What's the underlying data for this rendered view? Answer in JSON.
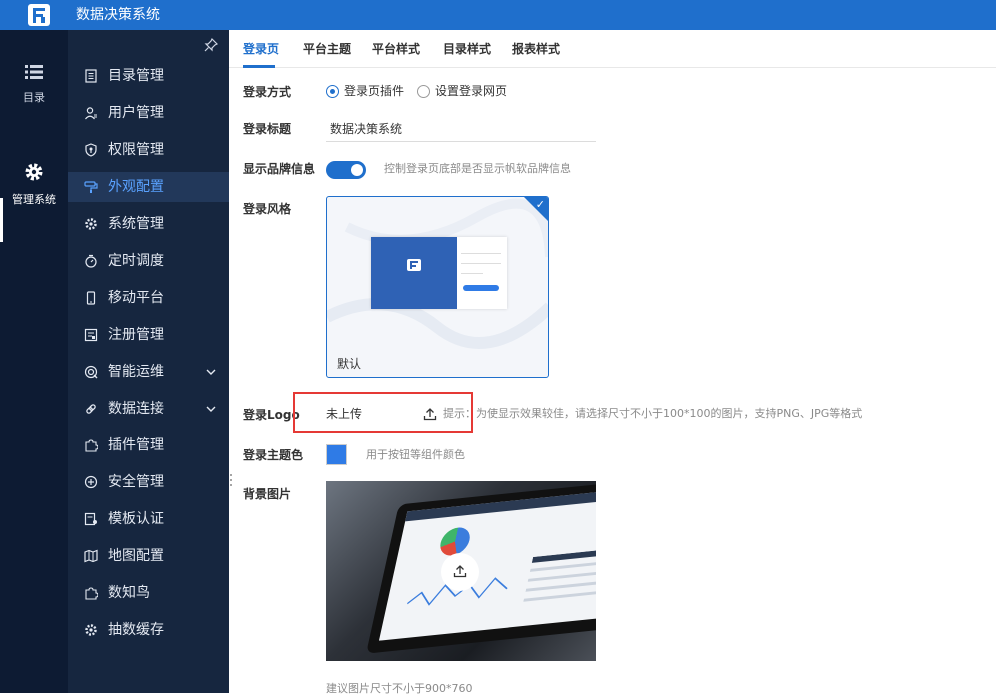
{
  "header": {
    "title": "数据决策系统",
    "bg_color": "#1f6fcc"
  },
  "rail": {
    "items": [
      {
        "label": "目录",
        "icon": "list-icon"
      },
      {
        "label": "管理系统",
        "icon": "gear-icon"
      }
    ]
  },
  "sidebar": {
    "items": [
      {
        "label": "目录管理",
        "icon": "document-list-icon"
      },
      {
        "label": "用户管理",
        "icon": "user-icon"
      },
      {
        "label": "权限管理",
        "icon": "shield-key-icon"
      },
      {
        "label": "外观配置",
        "icon": "paint-roller-icon",
        "active": true
      },
      {
        "label": "系统管理",
        "icon": "gear-icon"
      },
      {
        "label": "定时调度",
        "icon": "stopwatch-icon"
      },
      {
        "label": "移动平台",
        "icon": "mobile-icon"
      },
      {
        "label": "注册管理",
        "icon": "register-icon"
      },
      {
        "label": "智能运维",
        "icon": "ops-icon",
        "expandable": true
      },
      {
        "label": "数据连接",
        "icon": "link-icon",
        "expandable": true
      },
      {
        "label": "插件管理",
        "icon": "puzzle-icon"
      },
      {
        "label": "安全管理",
        "icon": "shield-plus-icon"
      },
      {
        "label": "模板认证",
        "icon": "certificate-icon"
      },
      {
        "label": "地图配置",
        "icon": "map-icon"
      },
      {
        "label": "数知鸟",
        "icon": "puzzle-icon"
      },
      {
        "label": "抽数缓存",
        "icon": "gear-icon"
      }
    ]
  },
  "tabs": [
    {
      "label": "登录页",
      "active": true
    },
    {
      "label": "平台主题"
    },
    {
      "label": "平台样式"
    },
    {
      "label": "目录样式"
    },
    {
      "label": "报表样式"
    }
  ],
  "form": {
    "login_method": {
      "label": "登录方式",
      "options": [
        {
          "label": "登录页插件",
          "selected": true
        },
        {
          "label": "设置登录网页",
          "selected": false
        }
      ]
    },
    "login_title": {
      "label": "登录标题",
      "value": "数据决策系统"
    },
    "show_brand": {
      "label": "显示品牌信息",
      "on": true,
      "hint": "控制登录页底部是否显示帆软品牌信息"
    },
    "login_style": {
      "label": "登录风格",
      "card_name": "默认"
    },
    "login_logo": {
      "label": "登录Logo",
      "value": "未上传",
      "hint": "提示：为使显示效果较佳，请选择尺寸不小于100*100的图片，支持PNG、JPG等格式"
    },
    "theme_color": {
      "label": "登录主题色",
      "color": "#2f7be6",
      "hint": "用于按钮等组件颜色"
    },
    "background": {
      "label": "背景图片",
      "hint": "建议图片尺寸不小于900*760"
    }
  }
}
